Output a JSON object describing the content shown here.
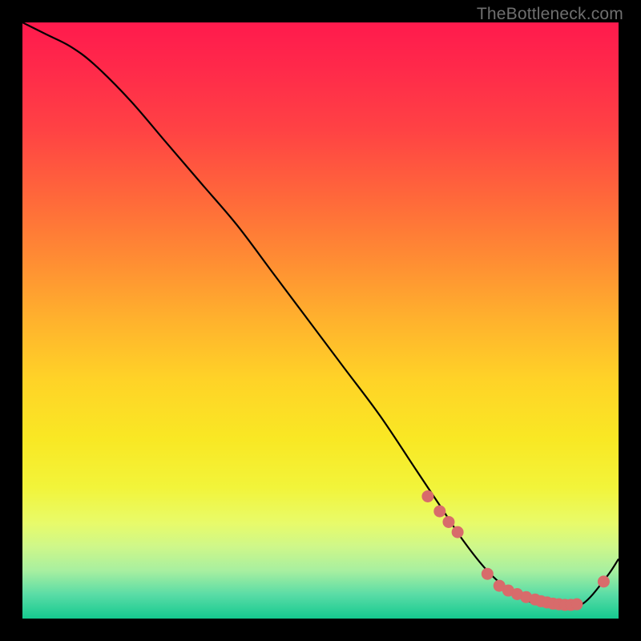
{
  "watermark": "TheBottleneck.com",
  "colors": {
    "curve_stroke": "#000000",
    "dot_fill": "#d86b6b",
    "dot_stroke": "#d86b6b"
  },
  "chart_data": {
    "type": "line",
    "title": "",
    "xlabel": "",
    "ylabel": "",
    "xlim": [
      0,
      100
    ],
    "ylim": [
      0,
      100
    ],
    "series": [
      {
        "name": "bottleneck-curve",
        "x": [
          0,
          4,
          8,
          12,
          18,
          24,
          30,
          36,
          42,
          48,
          54,
          60,
          66,
          70,
          74,
          78,
          82,
          86,
          90,
          94,
          98,
          100
        ],
        "y": [
          100,
          98,
          96,
          93,
          87,
          80,
          73,
          66,
          58,
          50,
          42,
          34,
          25,
          19,
          13,
          8,
          4.5,
          2.5,
          2,
          2.5,
          7,
          10
        ]
      }
    ],
    "highlight_points": {
      "name": "highlight-dots",
      "x": [
        68,
        70,
        71.5,
        73,
        78,
        80,
        81.5,
        83,
        84.5,
        86,
        87,
        88,
        89,
        90,
        91,
        92,
        93,
        97.5
      ],
      "y": [
        20.5,
        18,
        16.2,
        14.5,
        7.5,
        5.5,
        4.7,
        4.1,
        3.6,
        3.2,
        2.9,
        2.7,
        2.5,
        2.4,
        2.3,
        2.3,
        2.4,
        6.2
      ]
    }
  }
}
